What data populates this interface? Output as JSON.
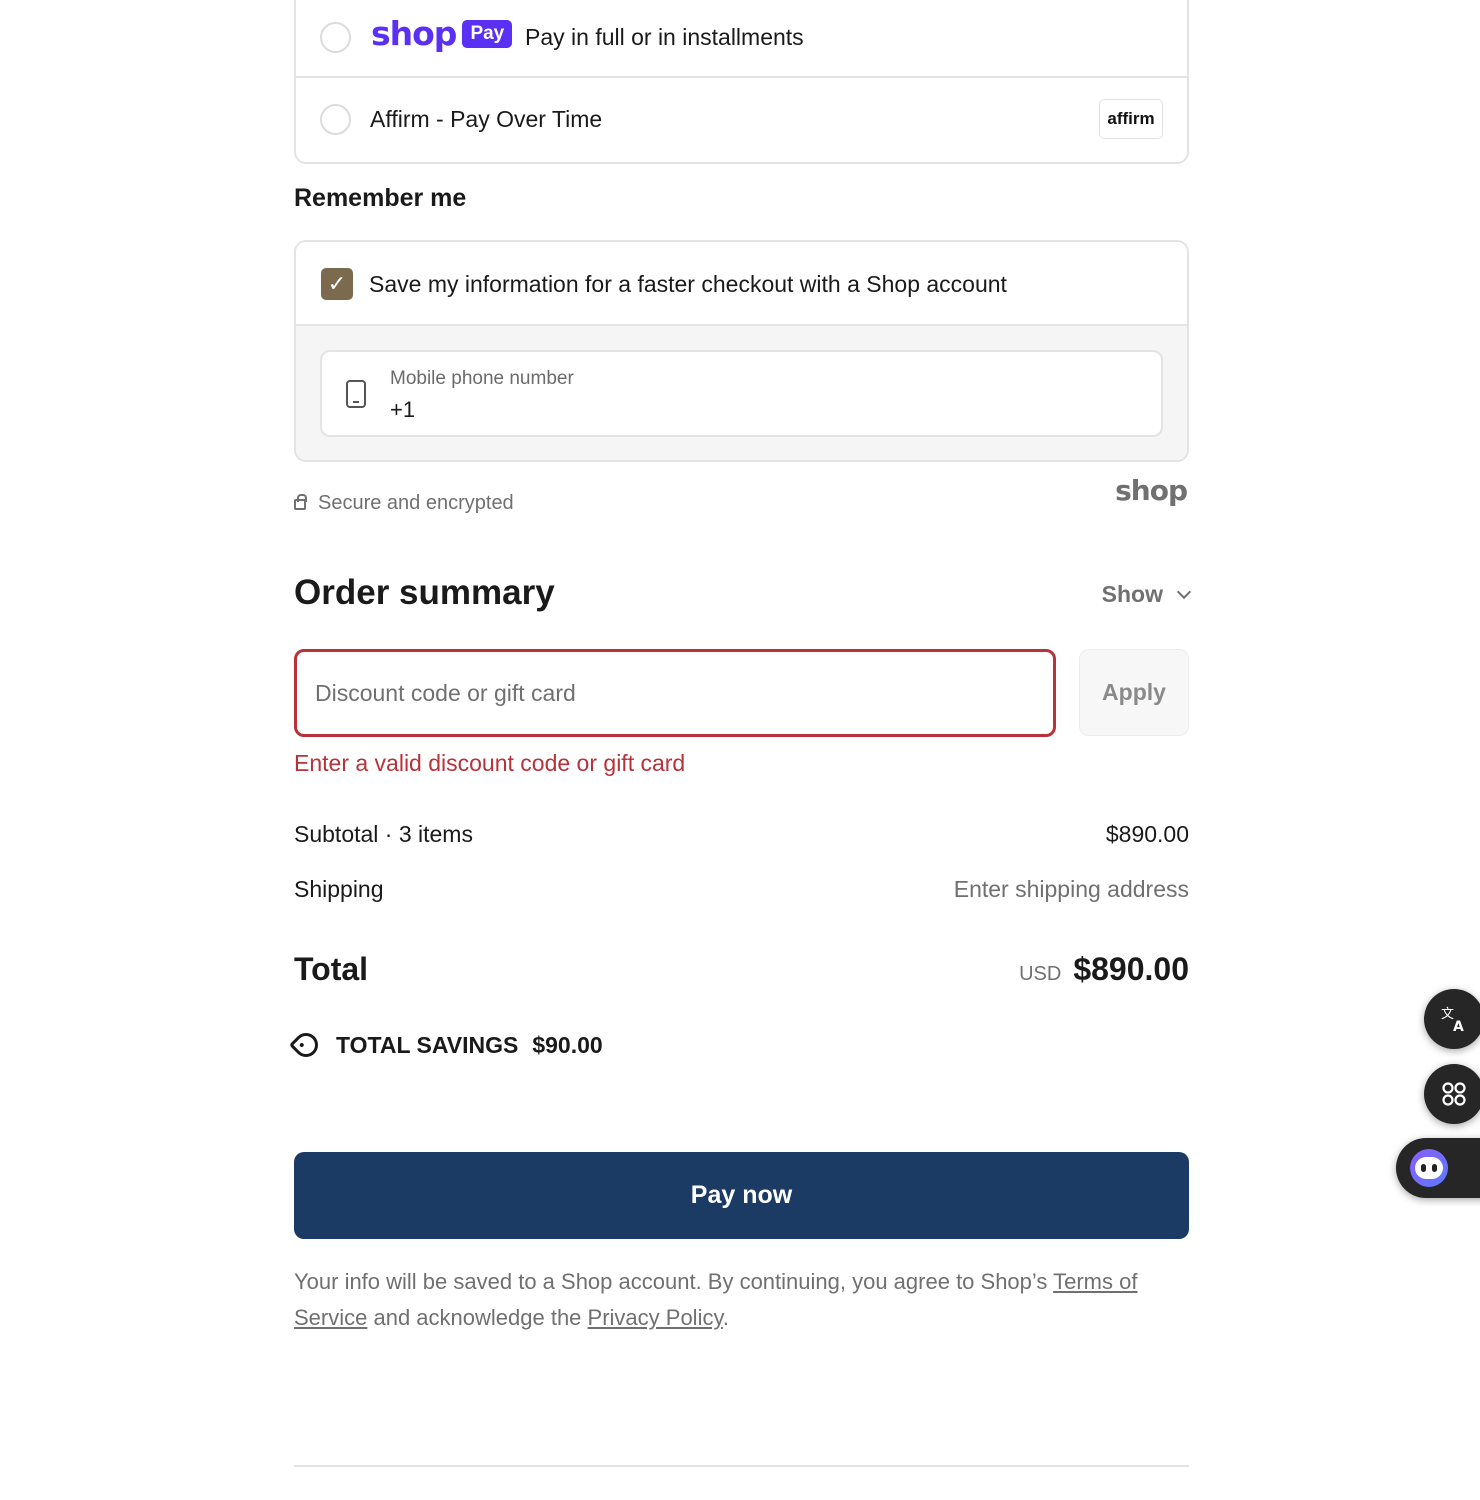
{
  "payment_options": {
    "shop_pay": {
      "logo_word": "shop",
      "logo_badge": "Pay",
      "label": "Pay in full or in installments",
      "brand_color": "#5a31f4"
    },
    "affirm": {
      "label": "Affirm - Pay Over Time",
      "logo_text": "affirm"
    }
  },
  "remember_me": {
    "title": "Remember me",
    "save_label": "Save my information for a faster checkout with a Shop account",
    "checked": true,
    "checkbox_color": "#7b6a4e",
    "phone_label": "Mobile phone number",
    "phone_value": "+1"
  },
  "security": {
    "text": "Secure and encrypted",
    "brand_mark": "shop"
  },
  "order_summary": {
    "title": "Order summary",
    "toggle_label": "Show",
    "discount": {
      "placeholder": "Discount code or gift card",
      "value": "",
      "apply_label": "Apply",
      "error": "Enter a valid discount code or gift card",
      "error_color": "#b8323a"
    },
    "subtotal_label": "Subtotal · 3 items",
    "subtotal_value": "$890.00",
    "shipping_label": "Shipping",
    "shipping_value": "Enter shipping address",
    "total_label": "Total",
    "total_currency": "USD",
    "total_value": "$890.00",
    "savings_label": "TOTAL SAVINGS",
    "savings_value": "$90.00"
  },
  "pay_now": {
    "label": "Pay now",
    "color": "#1b3a64"
  },
  "legal": {
    "prefix": "Your info will be saved to a Shop account. By continuing, you agree to Shop’s ",
    "terms_link": "Terms of Service",
    "middle": " and acknowledge the ",
    "privacy_link": "Privacy Policy",
    "suffix": "."
  },
  "side_widgets": {
    "translate_icon": "translate-icon",
    "apps_icon": "command-icon",
    "assistant_icon": "assistant-bot-icon"
  }
}
